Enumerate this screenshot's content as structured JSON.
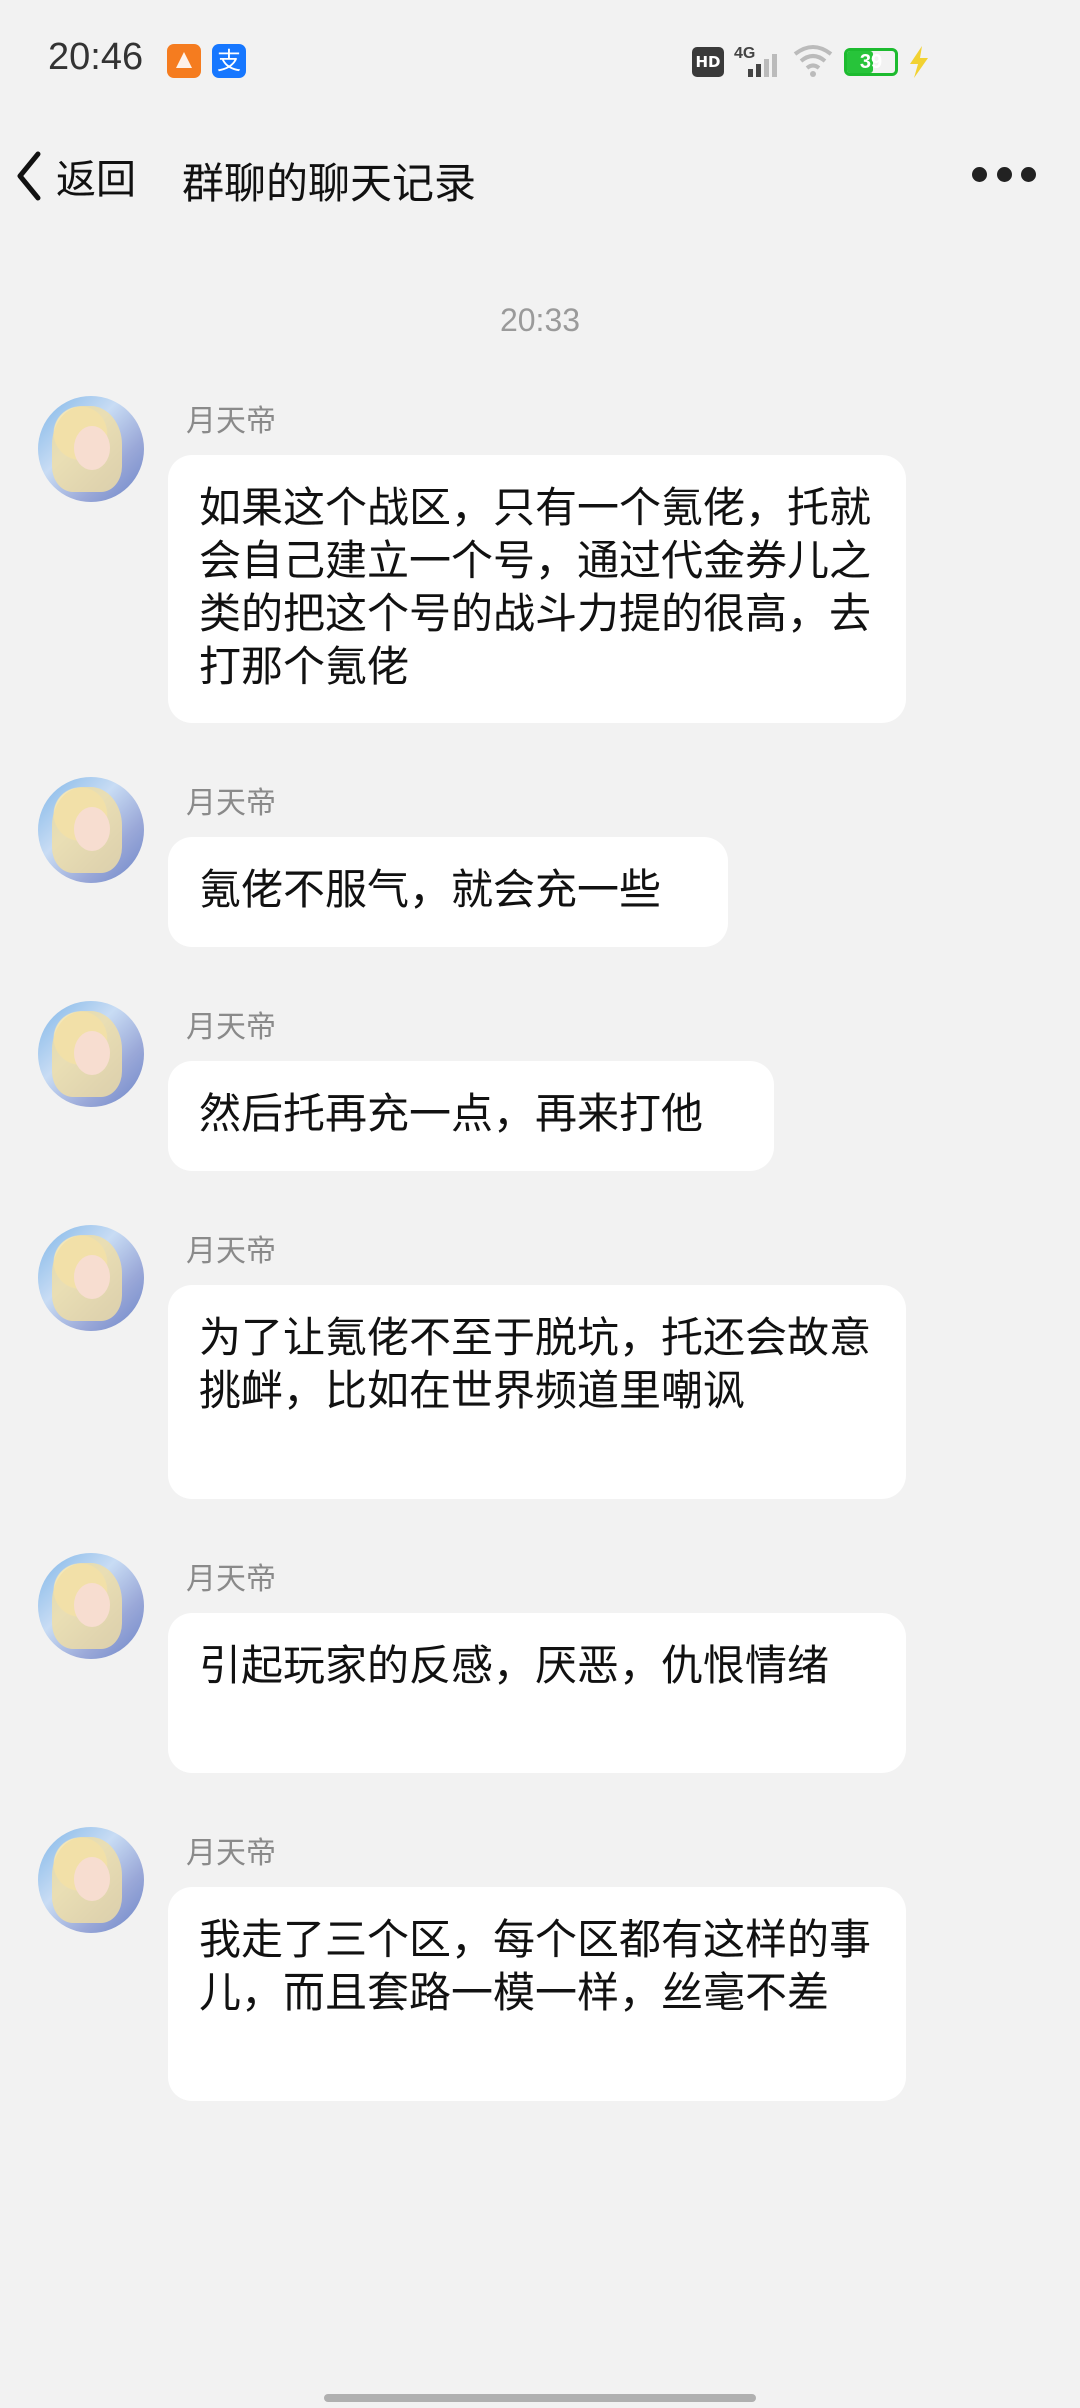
{
  "status_bar": {
    "time": "20:46",
    "hd_label": "HD",
    "network_label": "4G",
    "battery_level": "39",
    "icons": [
      "app-notification-icon",
      "alipay-icon",
      "hd-icon",
      "signal-icon",
      "wifi-icon",
      "battery-icon",
      "charging-icon"
    ]
  },
  "nav": {
    "back_label": "返回",
    "title": "群聊的聊天记录"
  },
  "chat": {
    "timestamp": "20:33",
    "messages": [
      {
        "sender": "月天帝",
        "text": "如果这个战区，只有一个氪佬，托就会自己建立一个号，通过代金券儿之类的把这个号的战斗力提的很高，去打那个氪佬"
      },
      {
        "sender": "月天帝",
        "text": "氪佬不服气，就会充一些"
      },
      {
        "sender": "月天帝",
        "text": "然后托再充一点，再来打他"
      },
      {
        "sender": "月天帝",
        "text": "为了让氪佬不至于脱坑，托还会故意挑衅，比如在世界频道里嘲讽"
      },
      {
        "sender": "月天帝",
        "text": "引起玩家的反感，厌恶，仇恨情绪"
      },
      {
        "sender": "月天帝",
        "text": "我走了三个区，每个区都有这样的事儿，而且套路一模一样，丝毫不差"
      }
    ]
  }
}
